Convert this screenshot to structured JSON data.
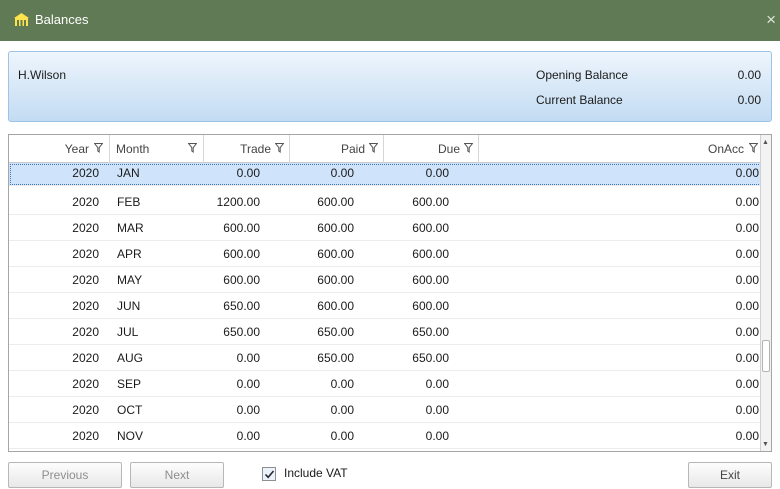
{
  "window": {
    "title": "Balances",
    "icon": "building-icon",
    "close_label": "×",
    "titlebar_color": "#5f7a54"
  },
  "header": {
    "name": "H.Wilson",
    "opening_balance_label": "Opening Balance",
    "opening_balance_value": "0.00",
    "current_balance_label": "Current Balance",
    "current_balance_value": "0.00"
  },
  "grid": {
    "columns": [
      "Year",
      "Month",
      "Trade",
      "Paid",
      "Due",
      "OnAcc"
    ],
    "selected_index": 0,
    "rows": [
      {
        "year": "2020",
        "month": "JAN",
        "trade": "0.00",
        "paid": "0.00",
        "due": "0.00",
        "onacc": "0.00"
      },
      {
        "year": "2020",
        "month": "FEB",
        "trade": "1200.00",
        "paid": "600.00",
        "due": "600.00",
        "onacc": "0.00"
      },
      {
        "year": "2020",
        "month": "MAR",
        "trade": "600.00",
        "paid": "600.00",
        "due": "600.00",
        "onacc": "0.00"
      },
      {
        "year": "2020",
        "month": "APR",
        "trade": "600.00",
        "paid": "600.00",
        "due": "600.00",
        "onacc": "0.00"
      },
      {
        "year": "2020",
        "month": "MAY",
        "trade": "600.00",
        "paid": "600.00",
        "due": "600.00",
        "onacc": "0.00"
      },
      {
        "year": "2020",
        "month": "JUN",
        "trade": "650.00",
        "paid": "600.00",
        "due": "600.00",
        "onacc": "0.00"
      },
      {
        "year": "2020",
        "month": "JUL",
        "trade": "650.00",
        "paid": "650.00",
        "due": "650.00",
        "onacc": "0.00"
      },
      {
        "year": "2020",
        "month": "AUG",
        "trade": "0.00",
        "paid": "650.00",
        "due": "650.00",
        "onacc": "0.00"
      },
      {
        "year": "2020",
        "month": "SEP",
        "trade": "0.00",
        "paid": "0.00",
        "due": "0.00",
        "onacc": "0.00"
      },
      {
        "year": "2020",
        "month": "OCT",
        "trade": "0.00",
        "paid": "0.00",
        "due": "0.00",
        "onacc": "0.00"
      },
      {
        "year": "2020",
        "month": "NOV",
        "trade": "0.00",
        "paid": "0.00",
        "due": "0.00",
        "onacc": "0.00"
      }
    ]
  },
  "footer": {
    "previous_label": "Previous",
    "next_label": "Next",
    "include_vat_label": "Include VAT",
    "include_vat_checked": true,
    "exit_label": "Exit"
  }
}
